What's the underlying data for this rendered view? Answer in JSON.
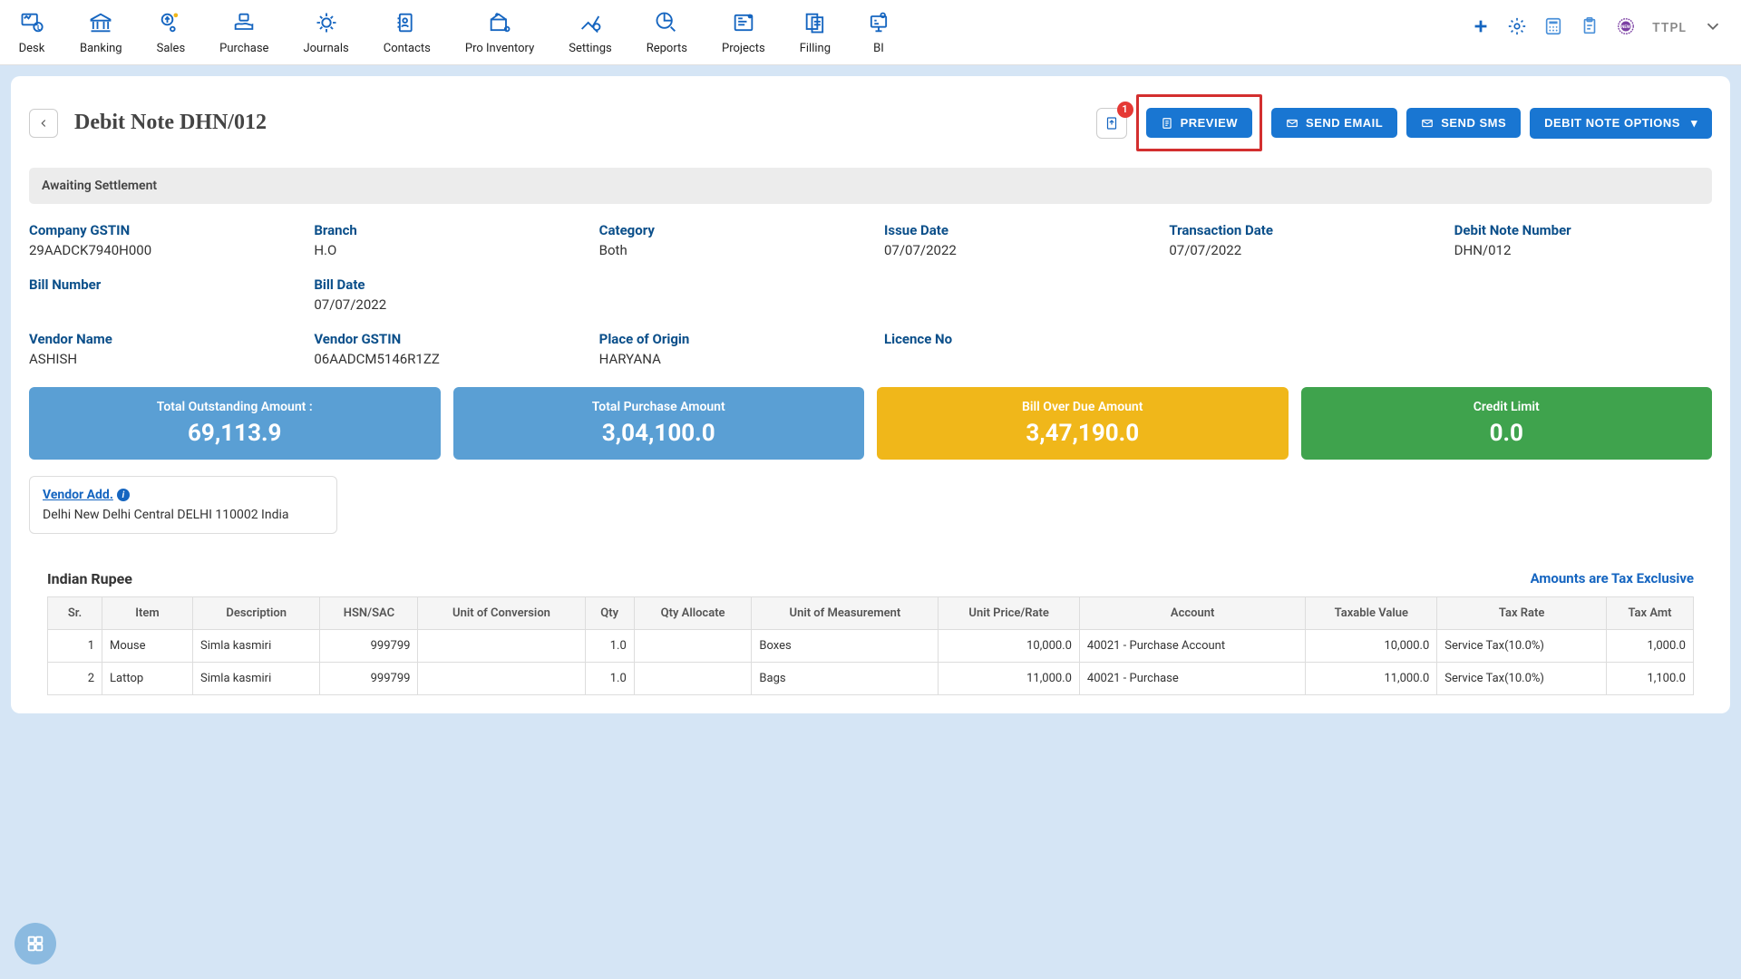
{
  "nav": {
    "items": [
      {
        "label": "Desk"
      },
      {
        "label": "Banking"
      },
      {
        "label": "Sales"
      },
      {
        "label": "Purchase"
      },
      {
        "label": "Journals"
      },
      {
        "label": "Contacts"
      },
      {
        "label": "Pro Inventory"
      },
      {
        "label": "Settings"
      },
      {
        "label": "Reports"
      },
      {
        "label": "Projects"
      },
      {
        "label": "Filling"
      },
      {
        "label": "BI"
      }
    ],
    "company": "TTPL"
  },
  "page": {
    "title": "Debit Note DHN/012",
    "attach_badge": "1",
    "preview": "PREVIEW",
    "send_email": "SEND EMAIL",
    "send_sms": "SEND SMS",
    "options": "DEBIT NOTE OPTIONS"
  },
  "status": "Awaiting Settlement",
  "info": {
    "company_gstin": {
      "label": "Company GSTIN",
      "value": "29AADCK7940H000"
    },
    "branch": {
      "label": "Branch",
      "value": "H.O"
    },
    "category": {
      "label": "Category",
      "value": "Both"
    },
    "issue_date": {
      "label": "Issue Date",
      "value": "07/07/2022"
    },
    "transaction_date": {
      "label": "Transaction Date",
      "value": "07/07/2022"
    },
    "debit_note_number": {
      "label": "Debit Note Number",
      "value": "DHN/012"
    },
    "bill_number": {
      "label": "Bill Number",
      "value": ""
    },
    "bill_date": {
      "label": "Bill Date",
      "value": "07/07/2022"
    },
    "vendor_name": {
      "label": "Vendor Name",
      "value": "ASHISH"
    },
    "vendor_gstin": {
      "label": "Vendor GSTIN",
      "value": "06AADCM5146R1ZZ"
    },
    "place_of_origin": {
      "label": "Place of Origin",
      "value": "HARYANA"
    },
    "licence_no": {
      "label": "Licence No",
      "value": ""
    }
  },
  "summary": {
    "outstanding": {
      "label": "Total Outstanding Amount :",
      "value": "69,113.9"
    },
    "purchase": {
      "label": "Total Purchase Amount",
      "value": "3,04,100.0"
    },
    "overdue": {
      "label": "Bill Over Due Amount",
      "value": "3,47,190.0"
    },
    "credit_limit": {
      "label": "Credit Limit",
      "value": "0.0"
    }
  },
  "vendor_add": {
    "label": "Vendor Add.",
    "address": "Delhi New Delhi Central DELHI 110002 India"
  },
  "currency": "Indian Rupee",
  "tax_note": "Amounts are Tax Exclusive",
  "table": {
    "headers": [
      "Sr.",
      "Item",
      "Description",
      "HSN/SAC",
      "Unit of Conversion",
      "Qty",
      "Qty Allocate",
      "Unit of Measurement",
      "Unit Price/Rate",
      "Account",
      "Taxable Value",
      "Tax Rate",
      "Tax Amt"
    ],
    "rows": [
      {
        "sr": "1",
        "item": "Mouse",
        "desc": "Simla kasmiri",
        "hsn": "999799",
        "uoc": "",
        "qty": "1.0",
        "qty_alloc": "",
        "uom": "Boxes",
        "rate": "10,000.0",
        "account": "40021 - Purchase Account",
        "taxable": "10,000.0",
        "tax_rate": "Service Tax(10.0%)",
        "tax_amt": "1,000.0"
      },
      {
        "sr": "2",
        "item": "Lattop",
        "desc": "Simla kasmiri",
        "hsn": "999799",
        "uoc": "",
        "qty": "1.0",
        "qty_alloc": "",
        "uom": "Bags",
        "rate": "11,000.0",
        "account": "40021 - Purchase",
        "taxable": "11,000.0",
        "tax_rate": "Service Tax(10.0%)",
        "tax_amt": "1,100.0"
      }
    ]
  }
}
